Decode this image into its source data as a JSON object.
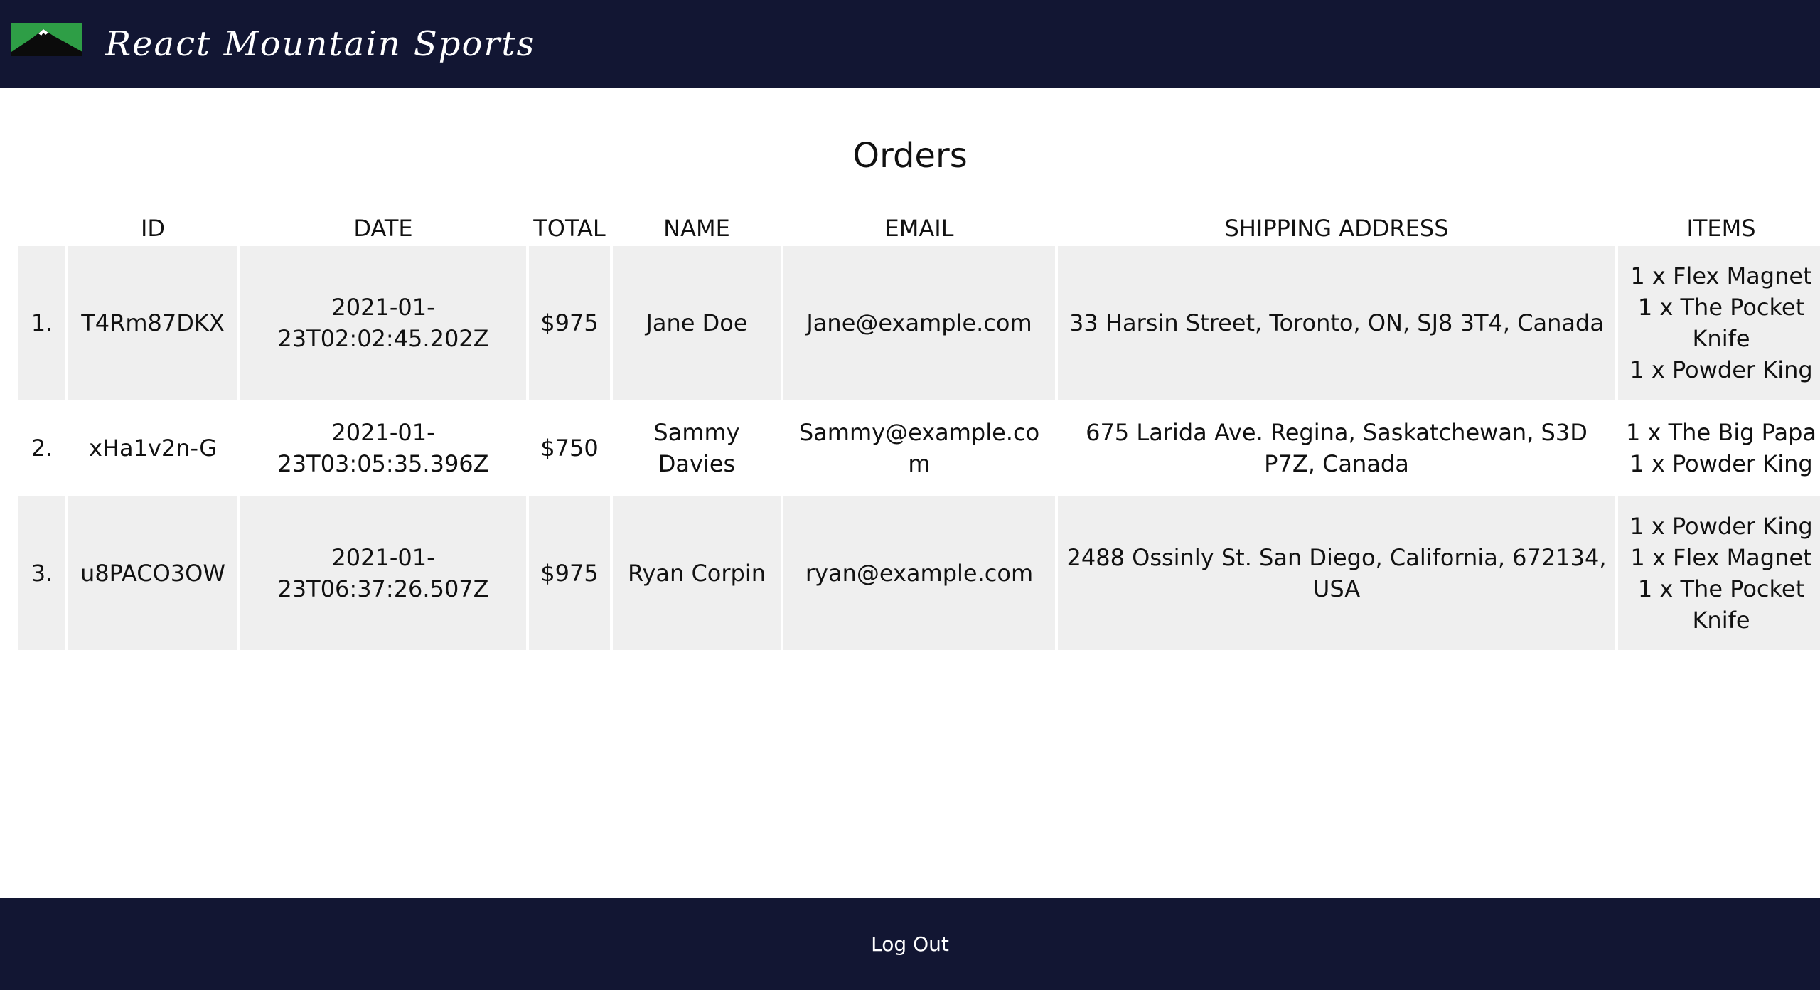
{
  "header": {
    "brand": "React Mountain Sports",
    "logo_icon": "mountain-logo-icon",
    "colors": {
      "background": "#121633",
      "logo_green": "#2e9e46"
    }
  },
  "page": {
    "title": "Orders"
  },
  "table": {
    "columns": [
      "",
      "ID",
      "DATE",
      "TOTAL",
      "NAME",
      "EMAIL",
      "SHIPPING ADDRESS",
      "ITEMS"
    ],
    "rows": [
      {
        "index": "1.",
        "id": "T4Rm87DKX",
        "date": "2021-01-23T02:02:45.202Z",
        "total": "$975",
        "name": "Jane Doe",
        "email": "Jane@example.com",
        "address": "33 Harsin Street, Toronto, ON, SJ8 3T4, Canada",
        "items": [
          "1 x Flex Magnet",
          "1 x The Pocket Knife",
          "1 x Powder King"
        ]
      },
      {
        "index": "2.",
        "id": "xHa1v2n-G",
        "date": "2021-01-23T03:05:35.396Z",
        "total": "$750",
        "name": "Sammy Davies",
        "email": "Sammy@example.com",
        "address": "675 Larida Ave. Regina, Saskatchewan, S3D P7Z, Canada",
        "items": [
          "1 x The Big Papa",
          "1 x Powder King"
        ]
      },
      {
        "index": "3.",
        "id": "u8PACO3OW",
        "date": "2021-01-23T06:37:26.507Z",
        "total": "$975",
        "name": "Ryan Corpin",
        "email": "ryan@example.com",
        "address": "2488 Ossinly St. San Diego, California, 672134, USA",
        "items": [
          "1 x Powder King",
          "1 x Flex Magnet",
          "1 x The Pocket Knife"
        ]
      }
    ]
  },
  "footer": {
    "logout_label": "Log Out"
  }
}
